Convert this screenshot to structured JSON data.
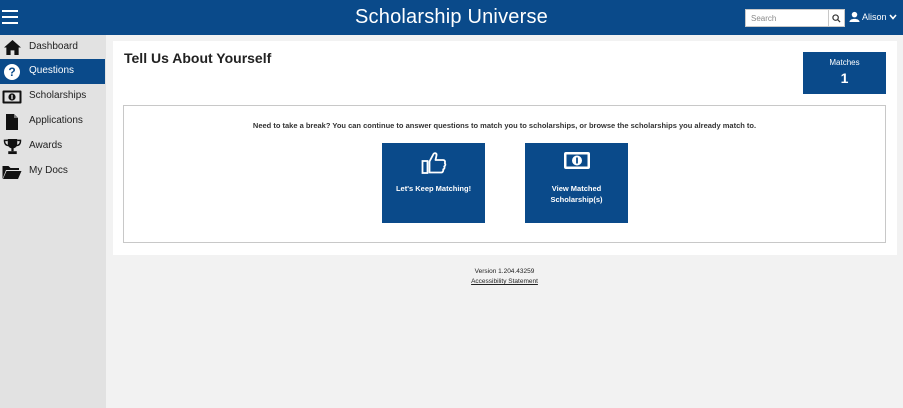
{
  "header": {
    "title": "Scholarship Universe",
    "search_placeholder": "Search",
    "user_name": "Alison"
  },
  "sidebar": {
    "items": [
      {
        "label": "Dashboard",
        "icon": "home-icon",
        "active": false
      },
      {
        "label": "Questions",
        "icon": "question-icon",
        "active": true
      },
      {
        "label": "Scholarships",
        "icon": "money-icon",
        "active": false
      },
      {
        "label": "Applications",
        "icon": "document-icon",
        "active": false
      },
      {
        "label": "Awards",
        "icon": "trophy-icon",
        "active": false
      },
      {
        "label": "My Docs",
        "icon": "folder-icon",
        "active": false
      }
    ]
  },
  "main": {
    "page_title": "Tell Us About Yourself",
    "matches": {
      "label": "Matches",
      "count": "1"
    },
    "break_message": "Need to take a break? You can continue to answer questions to match you to scholarships, or browse the scholarships you already match to.",
    "keep_matching_label": "Let's Keep Matching!",
    "view_matched_label": "View Matched Scholarship(s)"
  },
  "footer": {
    "version": "Version 1.204.43259",
    "accessibility_link": "Accessibility Statement"
  },
  "colors": {
    "brand": "#0a4a8a",
    "sidebar_bg": "#e2e2e2",
    "page_bg": "#f2f2f2"
  }
}
